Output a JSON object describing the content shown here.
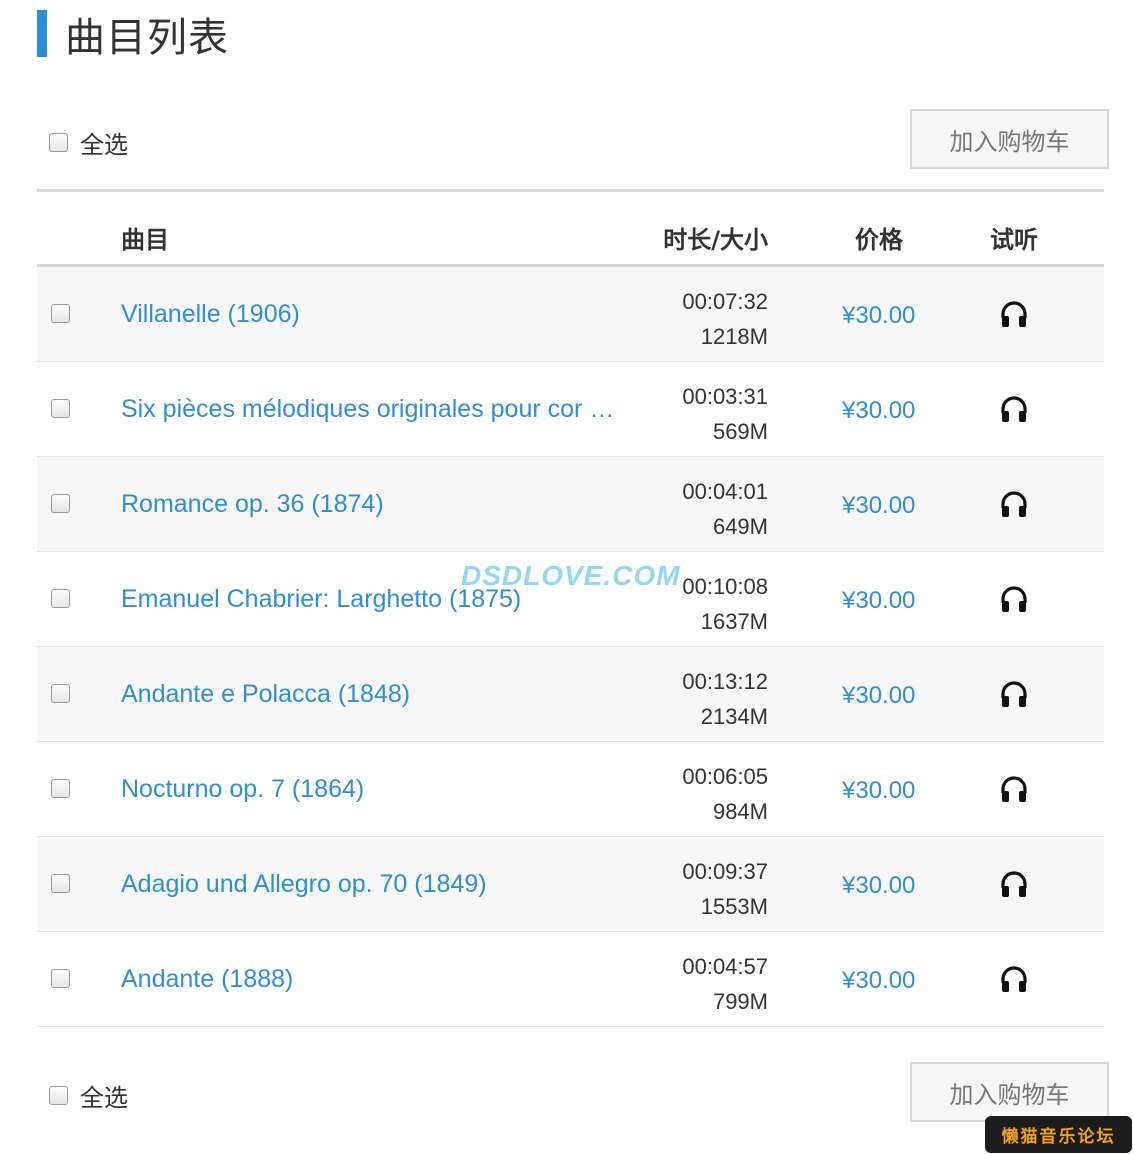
{
  "page": {
    "title": "曲目列表"
  },
  "toolbar_top": {
    "select_all": "全选",
    "cart_button": "加入购物车"
  },
  "toolbar_bottom": {
    "select_all": "全选",
    "cart_button": "加入购物车"
  },
  "table": {
    "headers": {
      "track": "曲目",
      "duration_size": "时长/大小",
      "price": "价格",
      "listen": "试听"
    },
    "rows": [
      {
        "title": "Villanelle (1906)",
        "duration": "00:07:32",
        "size": "1218M",
        "price": "¥30.00"
      },
      {
        "title": "Six pièces mélodiques originales pour cor et piano",
        "duration": "00:03:31",
        "size": "569M",
        "price": "¥30.00"
      },
      {
        "title": "Romance op. 36 (1874)",
        "duration": "00:04:01",
        "size": "649M",
        "price": "¥30.00"
      },
      {
        "title": "Emanuel Chabrier: Larghetto (1875)",
        "duration": "00:10:08",
        "size": "1637M",
        "price": "¥30.00"
      },
      {
        "title": "Andante e Polacca (1848)",
        "duration": "00:13:12",
        "size": "2134M",
        "price": "¥30.00"
      },
      {
        "title": "Nocturno op. 7 (1864)",
        "duration": "00:06:05",
        "size": "984M",
        "price": "¥30.00"
      },
      {
        "title": "Adagio und Allegro op. 70 (1849)",
        "duration": "00:09:37",
        "size": "1553M",
        "price": "¥30.00"
      },
      {
        "title": "Andante (1888)",
        "duration": "00:04:57",
        "size": "799M",
        "price": "¥30.00"
      }
    ]
  },
  "watermark": "DSDLOVE.COM",
  "corner_badge": "懒猫音乐论坛",
  "colors": {
    "accent": "#2a8fd6",
    "link": "#2f8fcf",
    "row_alt": "#f7f7f7"
  },
  "icons": {
    "listen": "headphones-icon"
  }
}
